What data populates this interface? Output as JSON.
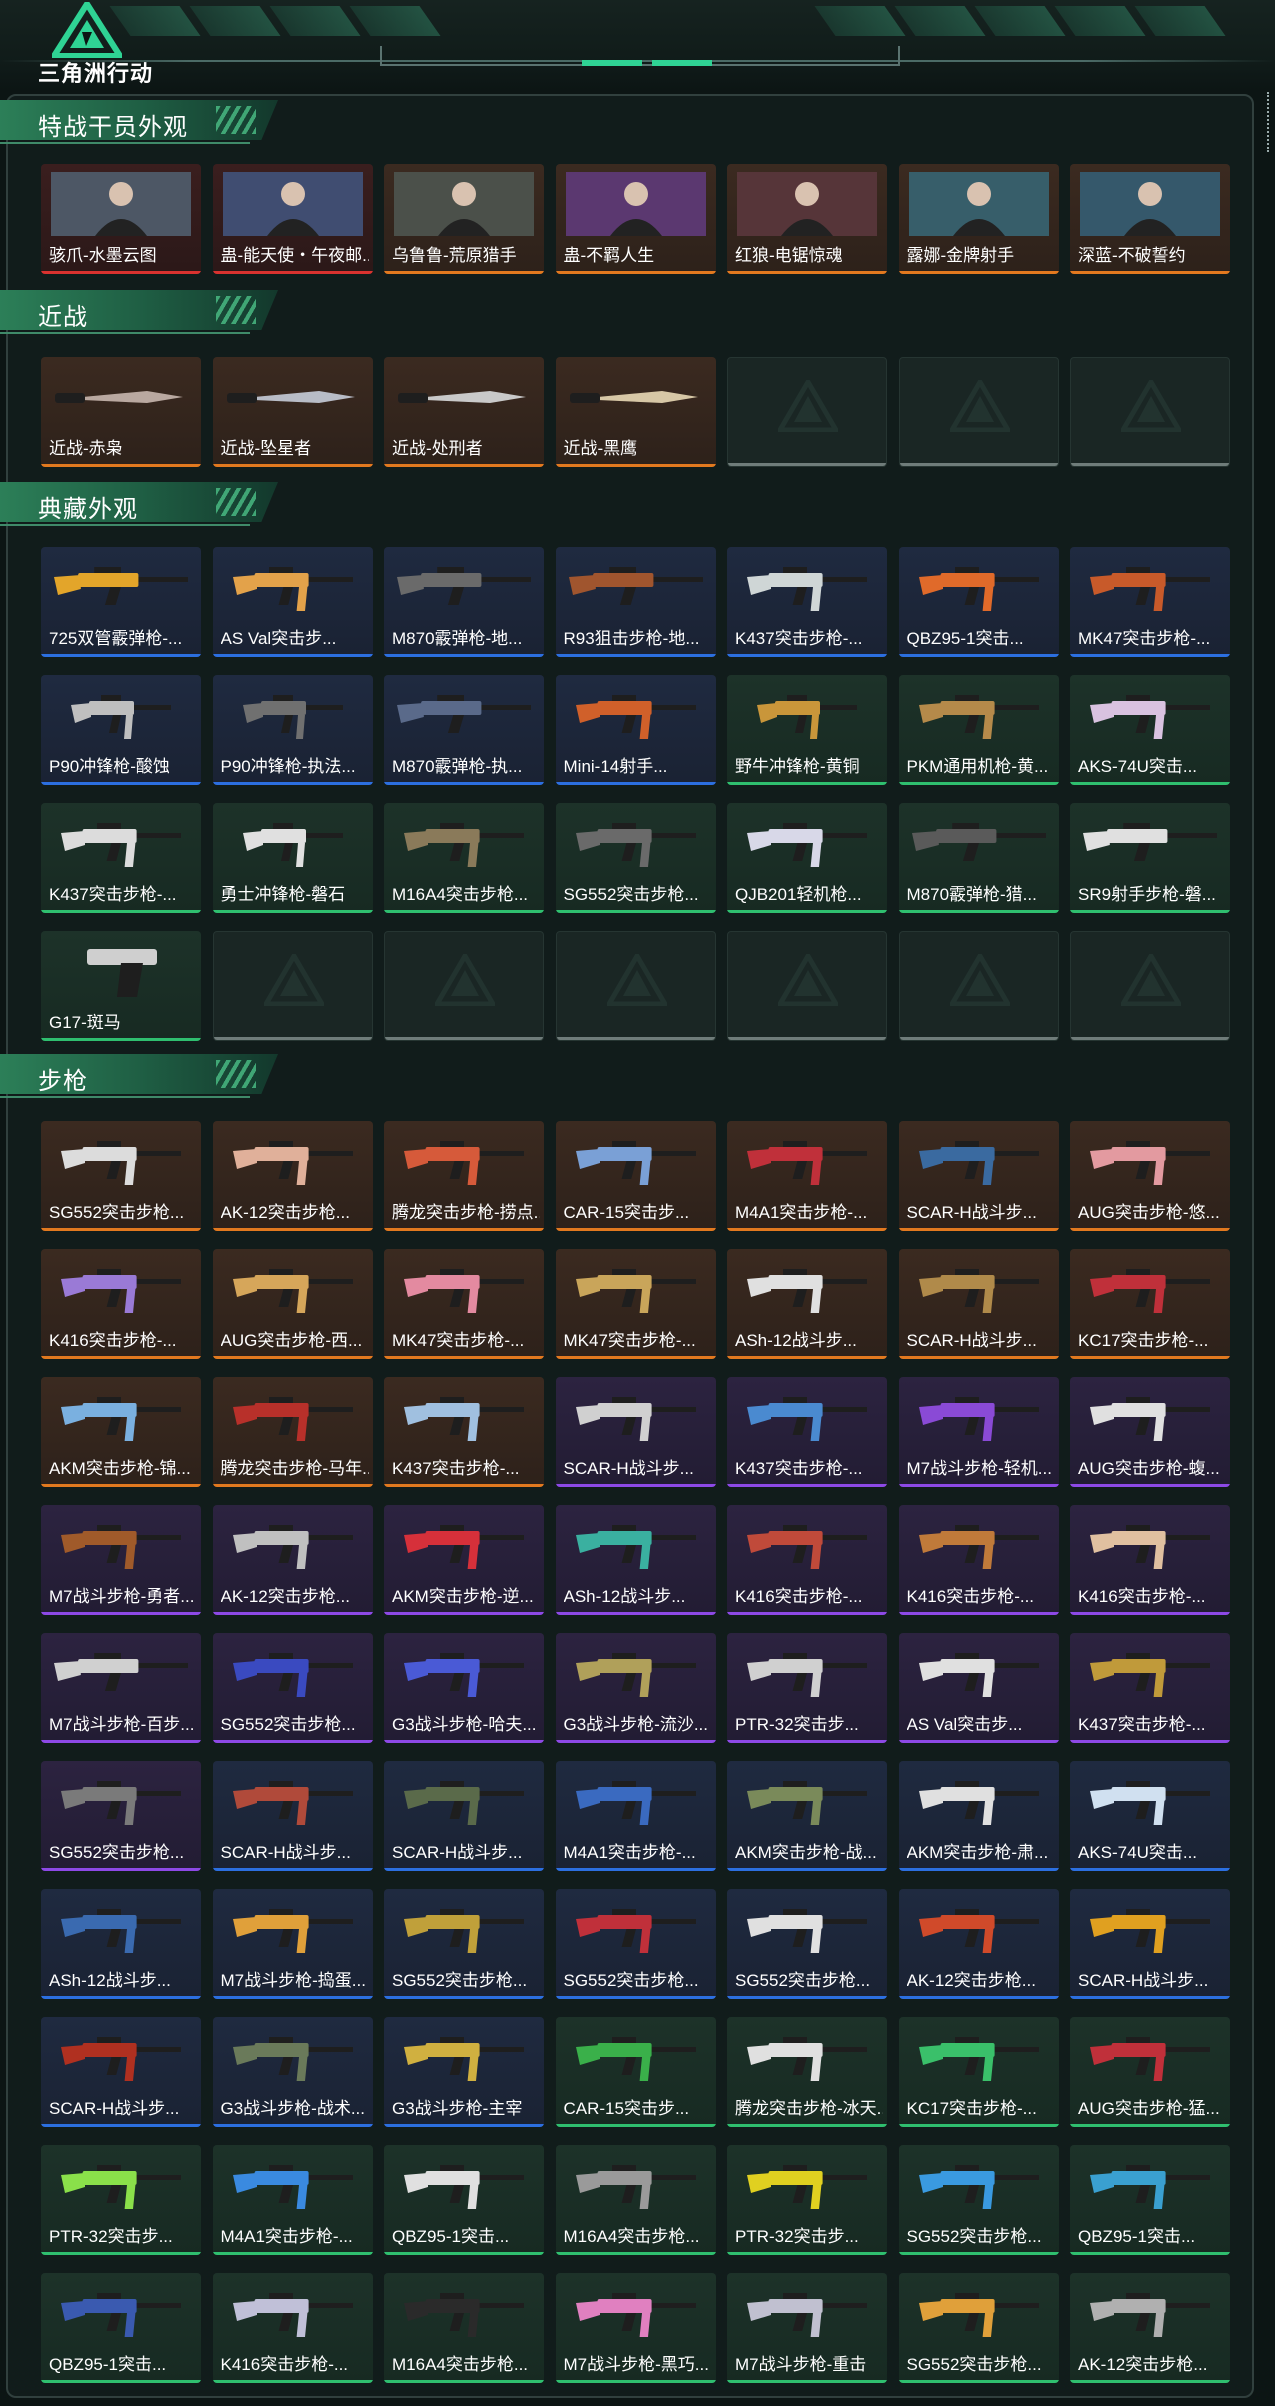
{
  "header": {
    "logo_text": "三角洲行动"
  },
  "sections": [
    {
      "title": "特战干员外观",
      "items": [
        {
          "label": "骇爪-水墨云图",
          "rarity": "red",
          "kind": "portrait",
          "accent": "#8fa3b8"
        },
        {
          "label": "蛊-能天使・午夜邮...",
          "rarity": "red",
          "kind": "portrait",
          "accent": "#6a86d9"
        },
        {
          "label": "乌鲁鲁-荒原猎手",
          "rarity": "orange",
          "kind": "portrait",
          "accent": "#8a8f6a"
        },
        {
          "label": "蛊-不羁人生",
          "rarity": "orange",
          "kind": "portrait",
          "accent": "#b84ad6"
        },
        {
          "label": "红狼-电锯惊魂",
          "rarity": "orange",
          "kind": "portrait",
          "accent": "#a8423a"
        },
        {
          "label": "露娜-金牌射手",
          "rarity": "orange",
          "kind": "portrait",
          "accent": "#4fb8c7"
        },
        {
          "label": "深蓝-不破誓约",
          "rarity": "orange",
          "kind": "portrait",
          "accent": "#4aa7c9"
        }
      ]
    },
    {
      "title": "近战",
      "items": [
        {
          "label": "近战-赤枭",
          "rarity": "orange",
          "kind": "knife",
          "accent": "#b9a8a0"
        },
        {
          "label": "近战-坠星者",
          "rarity": "orange",
          "kind": "knife",
          "accent": "#b8bcc6"
        },
        {
          "label": "近战-处刑者",
          "rarity": "orange",
          "kind": "knife",
          "accent": "#c9c9c9"
        },
        {
          "label": "近战-黑鹰",
          "rarity": "orange",
          "kind": "knife",
          "accent": "#d7c7a6"
        },
        {
          "label": "",
          "rarity": "empty"
        },
        {
          "label": "",
          "rarity": "empty"
        },
        {
          "label": "",
          "rarity": "empty"
        }
      ]
    },
    {
      "title": "典藏外观",
      "items": [
        {
          "label": "725双管霰弹枪-...",
          "rarity": "blue",
          "kind": "shotgun",
          "accent": "#e3a52a"
        },
        {
          "label": "AS Val突击步...",
          "rarity": "blue",
          "kind": "rifle",
          "accent": "#e3a24a"
        },
        {
          "label": "M870霰弹枪-地...",
          "rarity": "blue",
          "kind": "shotgun",
          "accent": "#6a6a6a"
        },
        {
          "label": "R93狙击步枪-地...",
          "rarity": "blue",
          "kind": "sniper",
          "accent": "#a0552e"
        },
        {
          "label": "K437突击步枪-...",
          "rarity": "blue",
          "kind": "rifle",
          "accent": "#cfd6d6"
        },
        {
          "label": "QBZ95-1突击...",
          "rarity": "blue",
          "kind": "bullpup",
          "accent": "#e06a2a"
        },
        {
          "label": "MK47突击步枪-...",
          "rarity": "blue",
          "kind": "rifle",
          "accent": "#c85a2a"
        },
        {
          "label": "P90冲锋枪-酸蚀",
          "rarity": "blue",
          "kind": "smg",
          "accent": "#bfbfbf"
        },
        {
          "label": "P90冲锋枪-执法...",
          "rarity": "blue",
          "kind": "smg",
          "accent": "#707070"
        },
        {
          "label": "M870霰弹枪-执...",
          "rarity": "blue",
          "kind": "shotgun",
          "accent": "#5a6a8a"
        },
        {
          "label": "Mini-14射手...",
          "rarity": "blue",
          "kind": "rifle",
          "accent": "#d0602a"
        },
        {
          "label": "野牛冲锋枪-黄铜",
          "rarity": "green",
          "kind": "smg",
          "accent": "#c9963a"
        },
        {
          "label": "PKM通用机枪-黄...",
          "rarity": "green",
          "kind": "lmg",
          "accent": "#b58a4a"
        },
        {
          "label": "AKS-74U突击...",
          "rarity": "green",
          "kind": "rifle",
          "accent": "#d9c2e0"
        },
        {
          "label": "K437突击步枪-...",
          "rarity": "green",
          "kind": "rifle",
          "accent": "#dcdcdc"
        },
        {
          "label": "勇士冲锋枪-磐石",
          "rarity": "green",
          "kind": "smg",
          "accent": "#e0e0e0"
        },
        {
          "label": "M16A4突击步枪...",
          "rarity": "green",
          "kind": "rifle",
          "accent": "#8a7a5a"
        },
        {
          "label": "SG552突击步枪...",
          "rarity": "green",
          "kind": "rifle",
          "accent": "#6a6a6a"
        },
        {
          "label": "QJB201轻机枪...",
          "rarity": "green",
          "kind": "lmg",
          "accent": "#d8d8e8"
        },
        {
          "label": "M870霰弹枪-猎...",
          "rarity": "green",
          "kind": "shotgun",
          "accent": "#5a5a5a"
        },
        {
          "label": "SR9射手步枪-磐...",
          "rarity": "green",
          "kind": "sniper",
          "accent": "#e0e0e0"
        },
        {
          "label": "G17-斑马",
          "rarity": "green",
          "kind": "pistol",
          "accent": "#cfcfcf"
        },
        {
          "label": "",
          "rarity": "empty"
        },
        {
          "label": "",
          "rarity": "empty"
        },
        {
          "label": "",
          "rarity": "empty"
        },
        {
          "label": "",
          "rarity": "empty"
        },
        {
          "label": "",
          "rarity": "empty"
        },
        {
          "label": "",
          "rarity": "empty"
        }
      ]
    },
    {
      "title": "步枪",
      "items": [
        {
          "label": "SG552突击步枪...",
          "rarity": "orange",
          "kind": "rifle",
          "accent": "#dcdcdc"
        },
        {
          "label": "AK-12突击步枪...",
          "rarity": "orange",
          "kind": "rifle",
          "accent": "#e0b09a"
        },
        {
          "label": "腾龙突击步枪-捞点...",
          "rarity": "orange",
          "kind": "rifle",
          "accent": "#d65a3a"
        },
        {
          "label": "CAR-15突击步...",
          "rarity": "orange",
          "kind": "rifle",
          "accent": "#7aa0d6"
        },
        {
          "label": "M4A1突击步枪-...",
          "rarity": "orange",
          "kind": "rifle",
          "accent": "#c0303a"
        },
        {
          "label": "SCAR-H战斗步...",
          "rarity": "orange",
          "kind": "rifle",
          "accent": "#3a6aa0"
        },
        {
          "label": "AUG突击步枪-悠...",
          "rarity": "orange",
          "kind": "bullpup",
          "accent": "#e39aa0"
        },
        {
          "label": "K416突击步枪-...",
          "rarity": "orange",
          "kind": "rifle",
          "accent": "#9a7ad6"
        },
        {
          "label": "AUG突击步枪-西...",
          "rarity": "orange",
          "kind": "bullpup",
          "accent": "#d6a65a"
        },
        {
          "label": "MK47突击步枪-...",
          "rarity": "orange",
          "kind": "rifle",
          "accent": "#e38aa0"
        },
        {
          "label": "MK47突击步枪-...",
          "rarity": "orange",
          "kind": "rifle",
          "accent": "#c9a55a"
        },
        {
          "label": "ASh-12战斗步...",
          "rarity": "orange",
          "kind": "bullpup",
          "accent": "#e0e0e0"
        },
        {
          "label": "SCAR-H战斗步...",
          "rarity": "orange",
          "kind": "rifle",
          "accent": "#b08a4a"
        },
        {
          "label": "KC17突击步枪-...",
          "rarity": "orange",
          "kind": "rifle",
          "accent": "#c0303a"
        },
        {
          "label": "AKM突击步枪-锦...",
          "rarity": "orange",
          "kind": "rifle",
          "accent": "#7ab0e0"
        },
        {
          "label": "腾龙突击步枪-马年...",
          "rarity": "orange",
          "kind": "rifle",
          "accent": "#b8302a"
        },
        {
          "label": "K437突击步枪-...",
          "rarity": "orange",
          "kind": "rifle",
          "accent": "#a0c0e0"
        },
        {
          "label": "SCAR-H战斗步...",
          "rarity": "purple",
          "kind": "rifle",
          "accent": "#d0d0d0"
        },
        {
          "label": "K437突击步枪-...",
          "rarity": "purple",
          "kind": "rifle",
          "accent": "#4a8ad0"
        },
        {
          "label": "M7战斗步枪-轻机...",
          "rarity": "purple",
          "kind": "rifle",
          "accent": "#8a4ad6"
        },
        {
          "label": "AUG突击步枪-蝮...",
          "rarity": "purple",
          "kind": "bullpup",
          "accent": "#e0e0e0"
        },
        {
          "label": "M7战斗步枪-勇者...",
          "rarity": "purple",
          "kind": "rifle",
          "accent": "#a05a2a"
        },
        {
          "label": "AK-12突击步枪...",
          "rarity": "purple",
          "kind": "rifle",
          "accent": "#c0c0c0"
        },
        {
          "label": "AKM突击步枪-逆...",
          "rarity": "purple",
          "kind": "rifle",
          "accent": "#d6303a"
        },
        {
          "label": "ASh-12战斗步...",
          "rarity": "purple",
          "kind": "bullpup",
          "accent": "#3ab0a0"
        },
        {
          "label": "K416突击步枪-...",
          "rarity": "purple",
          "kind": "rifle",
          "accent": "#c04a3a"
        },
        {
          "label": "K416突击步枪-...",
          "rarity": "purple",
          "kind": "rifle",
          "accent": "#c07a3a"
        },
        {
          "label": "K416突击步枪-...",
          "rarity": "purple",
          "kind": "rifle",
          "accent": "#e0c0a0"
        },
        {
          "label": "M7战斗步枪-百步...",
          "rarity": "purple",
          "kind": "sniper",
          "accent": "#d0d0d0"
        },
        {
          "label": "SG552突击步枪...",
          "rarity": "purple",
          "kind": "rifle",
          "accent": "#3a4ac0"
        },
        {
          "label": "G3战斗步枪-哈夫...",
          "rarity": "purple",
          "kind": "rifle",
          "accent": "#4a5ad6"
        },
        {
          "label": "G3战斗步枪-流沙...",
          "rarity": "purple",
          "kind": "rifle",
          "accent": "#b0a05a"
        },
        {
          "label": "PTR-32突击步...",
          "rarity": "purple",
          "kind": "rifle",
          "accent": "#d0d0d0"
        },
        {
          "label": "AS Val突击步...",
          "rarity": "purple",
          "kind": "rifle",
          "accent": "#e0e0e0"
        },
        {
          "label": "K437突击步枪-...",
          "rarity": "purple",
          "kind": "rifle",
          "accent": "#c09a3a"
        },
        {
          "label": "SG552突击步枪...",
          "rarity": "purple",
          "kind": "rifle",
          "accent": "#7a7a7a"
        },
        {
          "label": "SCAR-H战斗步...",
          "rarity": "blue",
          "kind": "rifle",
          "accent": "#b04a3a"
        },
        {
          "label": "SCAR-H战斗步...",
          "rarity": "blue",
          "kind": "rifle",
          "accent": "#5a6a4a"
        },
        {
          "label": "M4A1突击步枪-...",
          "rarity": "blue",
          "kind": "rifle",
          "accent": "#3a6ac0"
        },
        {
          "label": "AKM突击步枪-战...",
          "rarity": "blue",
          "kind": "rifle",
          "accent": "#7a8a5a"
        },
        {
          "label": "AKM突击步枪-肃...",
          "rarity": "blue",
          "kind": "rifle",
          "accent": "#e0e0e0"
        },
        {
          "label": "AKS-74U突击...",
          "rarity": "blue",
          "kind": "rifle",
          "accent": "#d0e0f0"
        },
        {
          "label": "ASh-12战斗步...",
          "rarity": "blue",
          "kind": "bullpup",
          "accent": "#3a6ab0"
        },
        {
          "label": "M7战斗步枪-捣蛋...",
          "rarity": "blue",
          "kind": "rifle",
          "accent": "#e0a03a"
        },
        {
          "label": "SG552突击步枪...",
          "rarity": "blue",
          "kind": "rifle",
          "accent": "#c0a03a"
        },
        {
          "label": "SG552突击步枪...",
          "rarity": "blue",
          "kind": "rifle",
          "accent": "#c0303a"
        },
        {
          "label": "SG552突击步枪...",
          "rarity": "blue",
          "kind": "rifle",
          "accent": "#e0e0e0"
        },
        {
          "label": "AK-12突击步枪...",
          "rarity": "blue",
          "kind": "rifle",
          "accent": "#d04a2a"
        },
        {
          "label": "SCAR-H战斗步...",
          "rarity": "blue",
          "kind": "rifle",
          "accent": "#e0a020"
        },
        {
          "label": "SCAR-H战斗步...",
          "rarity": "blue",
          "kind": "rifle",
          "accent": "#b03020"
        },
        {
          "label": "G3战斗步枪-战术...",
          "rarity": "blue",
          "kind": "rifle",
          "accent": "#6a7a5a"
        },
        {
          "label": "G3战斗步枪-主宰",
          "rarity": "blue",
          "kind": "rifle",
          "accent": "#d0b040"
        },
        {
          "label": "CAR-15突击步...",
          "rarity": "green",
          "kind": "rifle",
          "accent": "#3ab04a"
        },
        {
          "label": "腾龙突击步枪-冰天...",
          "rarity": "green",
          "kind": "rifle",
          "accent": "#e0e0e0"
        },
        {
          "label": "KC17突击步枪-...",
          "rarity": "green",
          "kind": "rifle",
          "accent": "#3ac06a"
        },
        {
          "label": "AUG突击步枪-猛...",
          "rarity": "green",
          "kind": "bullpup",
          "accent": "#c0303a"
        },
        {
          "label": "PTR-32突击步...",
          "rarity": "green",
          "kind": "rifle",
          "accent": "#8ae04a"
        },
        {
          "label": "M4A1突击步枪-...",
          "rarity": "green",
          "kind": "rifle",
          "accent": "#3a8ae0"
        },
        {
          "label": "QBZ95-1突击...",
          "rarity": "green",
          "kind": "bullpup",
          "accent": "#e0e0e0"
        },
        {
          "label": "M16A4突击步枪...",
          "rarity": "green",
          "kind": "rifle",
          "accent": "#9a9a9a"
        },
        {
          "label": "PTR-32突击步...",
          "rarity": "green",
          "kind": "rifle",
          "accent": "#e0d020"
        },
        {
          "label": "SG552突击步枪...",
          "rarity": "green",
          "kind": "rifle",
          "accent": "#3a9ae0"
        },
        {
          "label": "QBZ95-1突击...",
          "rarity": "green",
          "kind": "bullpup",
          "accent": "#3aa0d0"
        },
        {
          "label": "QBZ95-1突击...",
          "rarity": "green",
          "kind": "bullpup",
          "accent": "#3a5ab0"
        },
        {
          "label": "K416突击步枪-...",
          "rarity": "green",
          "kind": "rifle",
          "accent": "#c0c0d8"
        },
        {
          "label": "M16A4突击步枪...",
          "rarity": "green",
          "kind": "rifle",
          "accent": "#2a2a2a"
        },
        {
          "label": "M7战斗步枪-黑巧...",
          "rarity": "green",
          "kind": "rifle",
          "accent": "#e080c0"
        },
        {
          "label": "M7战斗步枪-重击",
          "rarity": "green",
          "kind": "rifle",
          "accent": "#c0c0d0"
        },
        {
          "label": "SG552突击步枪...",
          "rarity": "green",
          "kind": "rifle",
          "accent": "#e0a03a"
        },
        {
          "label": "AK-12突击步枪...",
          "rarity": "green",
          "kind": "rifle",
          "accent": "#b0b0b0"
        }
      ]
    }
  ]
}
